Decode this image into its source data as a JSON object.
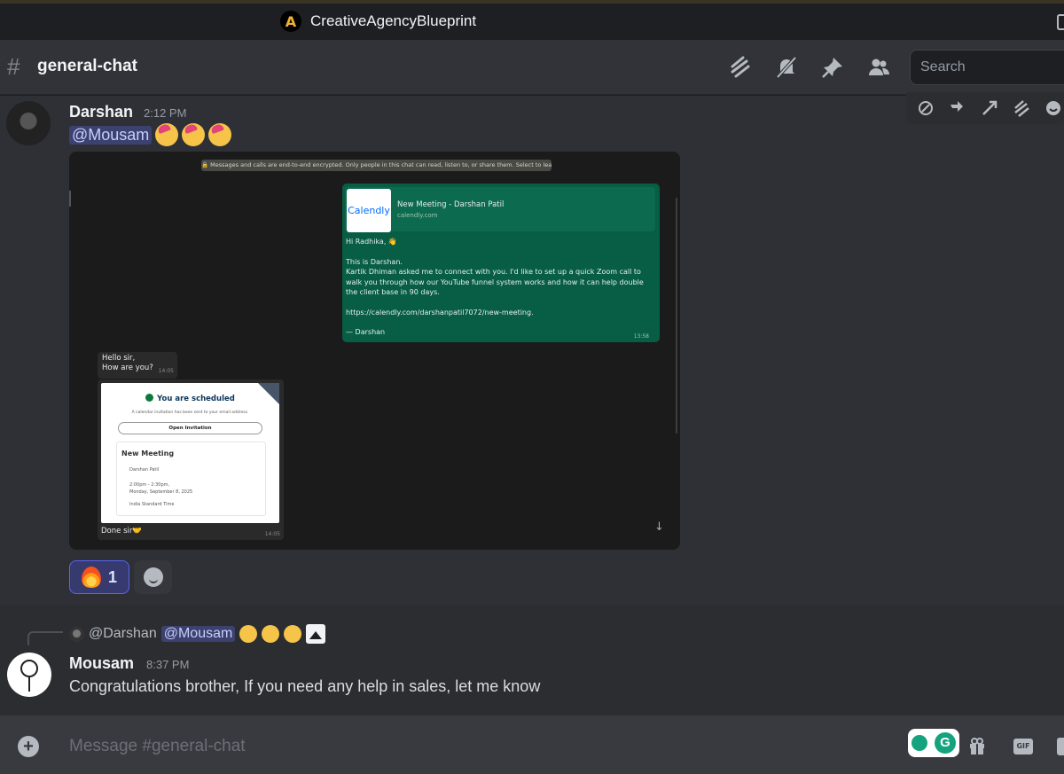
{
  "titlebar": {
    "server_name": "CreativeAgencyBlueprint",
    "server_logo_letter": "A"
  },
  "channel": {
    "name": "general-chat",
    "hash": "#"
  },
  "header_icons": [
    "threads-icon",
    "mute-bell-icon",
    "pin-icon",
    "members-icon"
  ],
  "search": {
    "placeholder": "Search"
  },
  "message_actions": [
    "add-link-icon",
    "reply-icon",
    "forward-icon",
    "threads-icon",
    "add-reaction-icon"
  ],
  "message1": {
    "author": "Darshan",
    "time": "2:12 PM",
    "mention": "@Mousam",
    "emojis": [
      "partying-face",
      "partying-face",
      "partying-face"
    ],
    "attachment": {
      "encryption_banner": "🔒 Messages and calls are end-to-end encrypted. Only people in this chat can read, listen to, or share them. Select to learn more.",
      "outgoing": {
        "link_logo": "Calendly",
        "link_title": "New Meeting - Darshan Patil",
        "link_domain": "calendly.com",
        "greeting": "Hi Radhika, 👋",
        "line_intro": "This is Darshan.",
        "body": "Kartik Dhiman asked me to connect with you. I'd like to set up a quick Zoom call to walk you through how our YouTube funnel system works and how it can help double the client base in 90 days.",
        "url": "https://calendly.com/darshanpatil7072/new-meeting.",
        "signoff": "— Darshan",
        "time": "13:58"
      },
      "incoming": {
        "line1": "Hello sir,",
        "line2": "How are you?",
        "time": "14:05"
      },
      "scheduled": {
        "title": "You are scheduled",
        "subtitle": "A calendar invitation has been sent to your email address.",
        "button": "Open Invitation",
        "meeting_title": "New Meeting",
        "host": "Darshan Patil",
        "time_range": "2:00pm - 2:30pm,",
        "date": "Monday, September 8, 2025",
        "timezone": "India Standard Time",
        "caption": "Done sir🤝",
        "time": "14:05"
      },
      "down_arrow": "↓"
    },
    "reactions": [
      {
        "emoji": "fire",
        "count": "1"
      }
    ]
  },
  "message2": {
    "reply_to_author": "@Darshan",
    "reply_mention": "@Mousam",
    "author": "Mousam",
    "time": "8:37 PM",
    "text": "Congratulations brother, If you need any help in sales, let me know"
  },
  "composer": {
    "placeholder": "Message #general-chat",
    "gif_label": "GIF",
    "grammarly_letter": "G"
  },
  "colors": {
    "background": "#2b2d31",
    "mention_bg": "#3c4270",
    "reaction_active": "#5865f2",
    "whatsapp_green": "#075e44"
  }
}
